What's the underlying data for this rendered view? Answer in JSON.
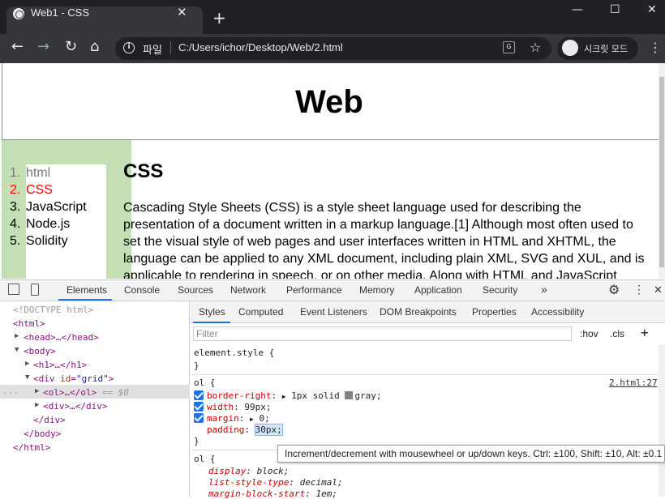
{
  "browser": {
    "tab_title": "Web1 - CSS",
    "tab_close": "✕",
    "new_tab": "+",
    "window_minimize": "—",
    "window_maximize": "☐",
    "window_close": "✕",
    "back": "←",
    "forward": "→",
    "reload": "↻",
    "home": "⌂",
    "scheme_label": "파일",
    "url": "C:/Users/ichor/Desktop/Web/2.html",
    "incognito_label": "시크릿 모드",
    "menu": "⋮",
    "star": "☆"
  },
  "page": {
    "h1": "Web",
    "list": [
      {
        "num": "1.",
        "label": "html",
        "color": "#808080"
      },
      {
        "num": "2.",
        "label": "CSS",
        "color": "#ff0000"
      },
      {
        "num": "3.",
        "label": "JavaScript",
        "color": "#000000"
      },
      {
        "num": "4.",
        "label": "Node.js",
        "color": "#000000"
      },
      {
        "num": "5.",
        "label": "Solidity",
        "color": "#000000"
      }
    ],
    "h2": "CSS",
    "paragraph": "Cascading Style Sheets (CSS) is a style sheet language used for describing the presentation of a document written in a markup language.[1] Although most often used to set the visual style of web pages and user interfaces written in HTML and XHTML, the language can be applied to any XML document, including plain XML, SVG and XUL, and is applicable to rendering in speech, or on other media. Along with HTML and JavaScript"
  },
  "devtools": {
    "tabs": [
      "Elements",
      "Console",
      "Sources",
      "Network",
      "Performance",
      "Memory",
      "Application",
      "Security"
    ],
    "more": "»",
    "gear": "⚙",
    "kebab": "⋮",
    "close": "✕",
    "dom": {
      "doctype": "<!DOCTYPE html>",
      "html": "<html>",
      "head": "<head>…</head>",
      "body": "<body>",
      "h1": "<h1>…</h1>",
      "div_open_tag": "<div ",
      "div_attr": "id",
      "div_val": "\"grid\"",
      "div_close": ">",
      "ol": "<ol>…</ol>",
      "ol_hint": "== $0",
      "div_inner": "<div>…</div>",
      "div_end": "</div>",
      "body_end": "</body>",
      "html_end": "</html>",
      "ellipsis": "..."
    },
    "styles_tabs": [
      "Styles",
      "Computed",
      "Event Listeners",
      "DOM Breakpoints",
      "Properties",
      "Accessibility"
    ],
    "filter_placeholder": "Filter",
    "hov": ":hov",
    "cls": ".cls",
    "plus": "+",
    "rules": {
      "element_style": "element.style {",
      "close_brace": "}",
      "ol_selector": "ol {",
      "ol_source": "2.html:27",
      "decls": [
        {
          "name": "border-right",
          "value": "1px solid ",
          "swatch_label": "gray",
          "swatch": "#808080"
        },
        {
          "name": "width",
          "value": "99px;"
        },
        {
          "name": "margin",
          "value": "0;"
        },
        {
          "name": "padding",
          "value": "30px;"
        }
      ],
      "ua_selector": "ol {",
      "ua_decls": [
        {
          "name": "display",
          "value": "block;"
        },
        {
          "name": "list-style-type",
          "value": "decimal;"
        },
        {
          "name": "margin-block-start",
          "value": "1em;"
        }
      ]
    },
    "tooltip": "Increment/decrement with mousewheel or up/down keys. Ctrl: ±100, Shift: ±10, Alt: ±0.1"
  }
}
